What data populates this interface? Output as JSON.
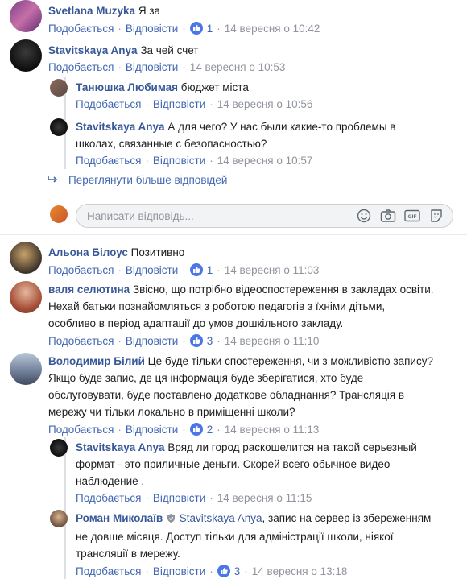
{
  "labels": {
    "like": "Подобається",
    "reply": "Відповісти",
    "more": "Переглянути більше відповідей",
    "placeholder": "Написати відповідь..."
  },
  "comments": [
    {
      "name": "Svetlana Muzyka",
      "text": "Я за",
      "likes": "1",
      "time": "14 вересня о 10:42"
    },
    {
      "name": "Stavitskaya Anya",
      "text": "За чей счет",
      "time": "14 вересня о 10:53"
    },
    {
      "name": "Танюшка Любимая",
      "text": "бюджет міста",
      "time": "14 вересня о 10:56"
    },
    {
      "name": "Stavitskaya Anya",
      "text": "А для чего? У нас были какие-то проблемы в школах, связанные с безопасностью?",
      "time": "14 вересня о 10:57"
    },
    {
      "name": "Альона Білоус",
      "text": "Позитивно",
      "likes": "1",
      "time": "14 вересня о 11:03"
    },
    {
      "name": "валя селютина",
      "text": "Звісно, що потрібно відеоспостереження в закладах освіти. Нехай батьки познайомляться з роботою педагогів з їхніми дітьми, особливо в період адаптації до умов дошкільного закладу.",
      "likes": "3",
      "time": "14 вересня о 11:10"
    },
    {
      "name": "Володимир Білий",
      "text": "Це буде тільки спостереження, чи з можливістю запису? Якщо буде запис, де ця інформація буде зберігатися, хто буде обслуговувати, буде поставлено додаткове обладнання? Трансляція в мережу чи тільки локально в приміщенні школи?",
      "likes": "2",
      "time": "14 вересня о 11:13"
    },
    {
      "name": "Stavitskaya Anya",
      "text": "Вряд ли город раскошелится на такой серьезный формат - это приличные деньги. Скорей всего обычное видео наблюдение .",
      "time": "14 вересня о 11:15"
    },
    {
      "name": "Роман Миколаїв",
      "tag": "Stavitskaya Anya",
      "text": ", запис на сервер із збереженням не довше місяця. Доступ тільки для адміністрації школи, ніякої трансляції в мережу.",
      "likes": "3",
      "time": "14 вересня о 13:18"
    }
  ],
  "colors": {
    "link": "#385898",
    "action": "#4267b2",
    "meta": "#90949c",
    "like": "#4a76e8"
  },
  "icons": [
    "like-icon",
    "reply-arrow-icon",
    "smile-icon",
    "camera-icon",
    "gif-icon",
    "sticker-icon",
    "verified-icon"
  ]
}
